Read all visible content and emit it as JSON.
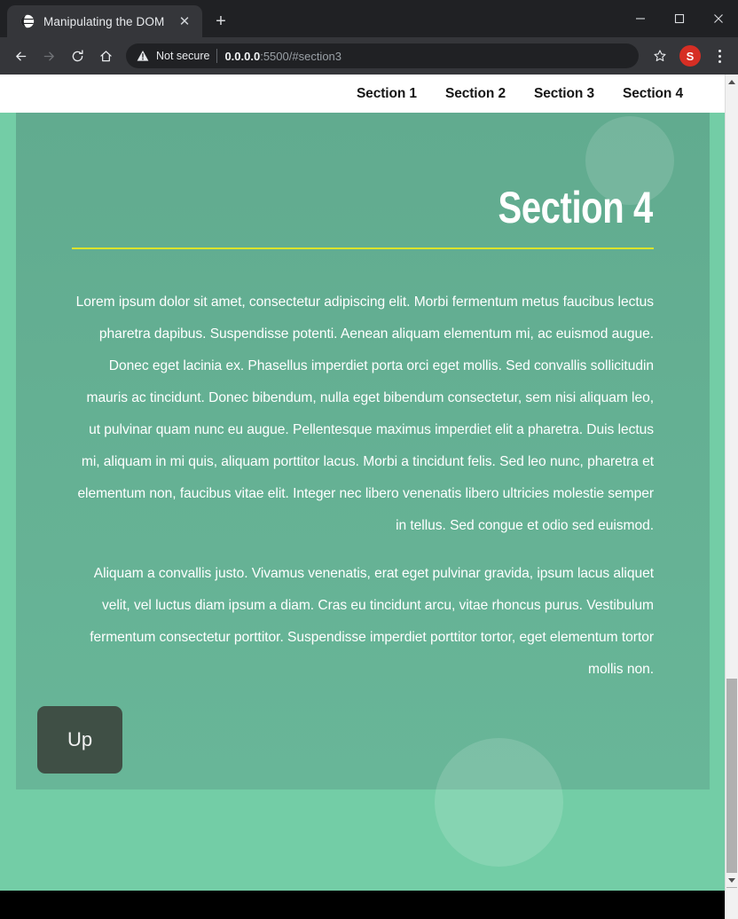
{
  "browser": {
    "tab": {
      "title": "Manipulating the DOM",
      "favicon_icon": "globe-icon",
      "close_icon": "close-icon"
    },
    "new_tab_icon": "plus-icon",
    "window_controls": {
      "minimize": "minimize-icon",
      "maximize": "maximize-icon",
      "close": "window-close-icon"
    },
    "toolbar": {
      "back_icon": "arrow-back-icon",
      "forward_icon": "arrow-forward-icon",
      "reload_icon": "reload-icon",
      "home_icon": "home-icon",
      "security_icon": "warning-triangle-icon",
      "security_label": "Not secure",
      "url_host": "0.0.0.0",
      "url_rest": ":5500/#section3",
      "bookmark_icon": "star-icon",
      "profile_initial": "S",
      "menu_icon": "kebab-menu-icon"
    }
  },
  "site_nav": {
    "items": [
      {
        "label": "Section 1",
        "href": "#section0"
      },
      {
        "label": "Section 2",
        "href": "#section1"
      },
      {
        "label": "Section 3",
        "href": "#section2"
      },
      {
        "label": "Section 4",
        "href": "#section3"
      }
    ]
  },
  "section": {
    "title": "Section 4",
    "paragraph_1": "Lorem ipsum dolor sit amet, consectetur adipiscing elit. Morbi fermentum metus faucibus lectus pharetra dapibus. Suspendisse potenti. Aenean aliquam elementum mi, ac euismod augue. Donec eget lacinia ex. Phasellus imperdiet porta orci eget mollis. Sed convallis sollicitudin mauris ac tincidunt. Donec bibendum, nulla eget bibendum consectetur, sem nisi aliquam leo, ut pulvinar quam nunc eu augue. Pellentesque maximus imperdiet elit a pharetra. Duis lectus mi, aliquam in mi quis, aliquam porttitor lacus. Morbi a tincidunt felis. Sed leo nunc, pharetra et elementum non, faucibus vitae elit. Integer nec libero venenatis libero ultricies molestie semper in tellus. Sed congue et odio sed euismod.",
    "paragraph_2": "Aliquam a convallis justo. Vivamus venenatis, erat eget pulvinar gravida, ipsum lacus aliquet velit, vel luctus diam ipsum a diam. Cras eu tincidunt arcu, vitae rhoncus purus. Vestibulum fermentum consectetur porttitor. Suspendisse imperdiet porttitor tortor, eget elementum tortor mollis non.",
    "up_button_label": "Up"
  },
  "colors": {
    "page_background": "#73cda6",
    "section_background": "#65b194",
    "accent_rule": "#dbe32c",
    "title_text": "#ffffff",
    "body_text": "#ffffff",
    "up_button_bg": "#3f4f45",
    "profile_avatar_bg": "#d62e24"
  },
  "scrollbar": {
    "up_arrow_icon": "scroll-up-arrow-icon",
    "down_arrow_icon": "scroll-down-arrow-icon",
    "thumb_position_percent": 72
  }
}
